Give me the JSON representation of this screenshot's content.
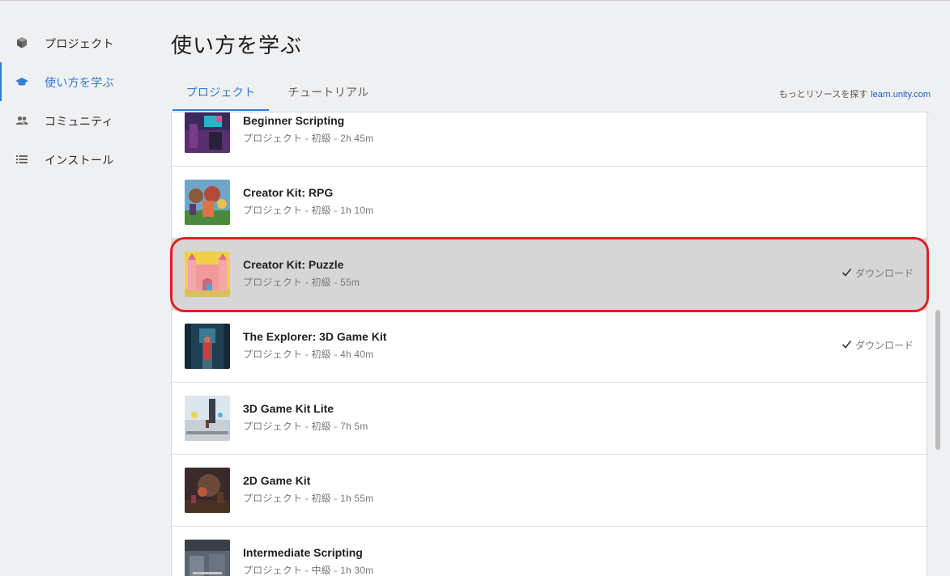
{
  "sidebar": {
    "items": [
      {
        "label": "プロジェクト",
        "icon": "cube-icon",
        "active": false
      },
      {
        "label": "使い方を学ぶ",
        "icon": "graduation-cap-icon",
        "active": true
      },
      {
        "label": "コミュニティ",
        "icon": "people-icon",
        "active": false
      },
      {
        "label": "インストール",
        "icon": "list-icon",
        "active": false
      }
    ]
  },
  "header": {
    "title": "使い方を学ぶ",
    "tabs": [
      {
        "label": "プロジェクト",
        "active": true
      },
      {
        "label": "チュートリアル",
        "active": false
      }
    ],
    "more_resources_text": "もっとリソースを探す",
    "more_resources_link": "learn.unity.com"
  },
  "colors": {
    "accent": "#2f7bd8",
    "highlight": "#e02020",
    "selected_row": "#d6d6d6"
  },
  "projects": [
    {
      "title": "Beginner Scripting",
      "meta": "プロジェクト - 初級 - 2h 45m",
      "download": ""
    },
    {
      "title": "Creator Kit: RPG",
      "meta": "プロジェクト - 初級 - 1h 10m",
      "download": ""
    },
    {
      "title": "Creator Kit: Puzzle",
      "meta": "プロジェクト - 初級 - 55m",
      "download": "ダウンロード"
    },
    {
      "title": "The Explorer: 3D Game Kit",
      "meta": "プロジェクト - 初級 - 4h 40m",
      "download": "ダウンロード"
    },
    {
      "title": "3D Game Kit Lite",
      "meta": "プロジェクト - 初級 - 7h 5m",
      "download": ""
    },
    {
      "title": "2D Game Kit",
      "meta": "プロジェクト - 初級 - 1h 55m",
      "download": ""
    },
    {
      "title": "Intermediate Scripting",
      "meta": "プロジェクト - 中級 - 1h 30m",
      "download": ""
    }
  ]
}
